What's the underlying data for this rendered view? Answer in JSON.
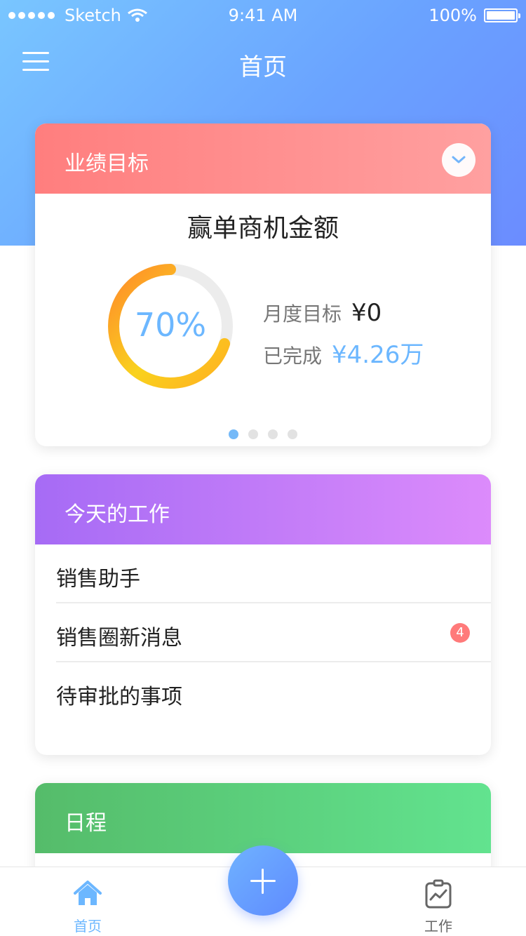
{
  "status_bar": {
    "carrier": "Sketch",
    "time": "9:41 AM",
    "battery": "100%"
  },
  "nav": {
    "title": "首页"
  },
  "goal_card": {
    "header": "业绩目标",
    "title": "赢单商机金额",
    "progress_label": "70%",
    "progress_fraction": 0.7,
    "monthly_target_label": "月度目标",
    "monthly_target_value": "¥0",
    "completed_label": "已完成",
    "completed_value": "¥4.26万",
    "pages": 4,
    "active_page": 0
  },
  "work_card": {
    "header": "今天的工作",
    "items": [
      {
        "label": "销售助手",
        "badge": ""
      },
      {
        "label": "销售圈新消息",
        "badge": "4"
      },
      {
        "label": "待审批的事项",
        "badge": ""
      }
    ]
  },
  "schedule_card": {
    "header": "日程"
  },
  "tabbar": {
    "home_label": "首页",
    "work_label": "工作"
  },
  "colors": {
    "accent": "#6cb7ff",
    "goal_header": "#ff7e7e",
    "work_header": "#a66bf5",
    "schedule_header": "#55bc6a",
    "badge": "#ff7a7a"
  },
  "icons": {
    "menu": "hamburger-icon",
    "collapse": "chevron-down-icon",
    "home": "home-icon",
    "work": "clipboard-chart-icon",
    "add": "plus-icon"
  }
}
